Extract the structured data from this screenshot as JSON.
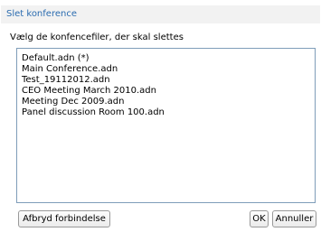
{
  "dialog": {
    "title": "Slet konference",
    "instruction": "Vælg de konfencefiler, der skal slettes"
  },
  "files": [
    "Default.adn (*)",
    "Main Conference.adn",
    "Test_19112012.adn",
    "CEO Meeting March 2010.adn",
    "Meeting Dec 2009.adn",
    "Panel discussion Room 100.adn"
  ],
  "buttons": {
    "disconnect_label": "Afbryd forbindelse",
    "ok_label": "OK",
    "cancel_label": "Annuller"
  },
  "colors": {
    "title_text": "#2b6cb0",
    "title_bar": "#f2f2f2",
    "list_border": "#7f9db9"
  }
}
